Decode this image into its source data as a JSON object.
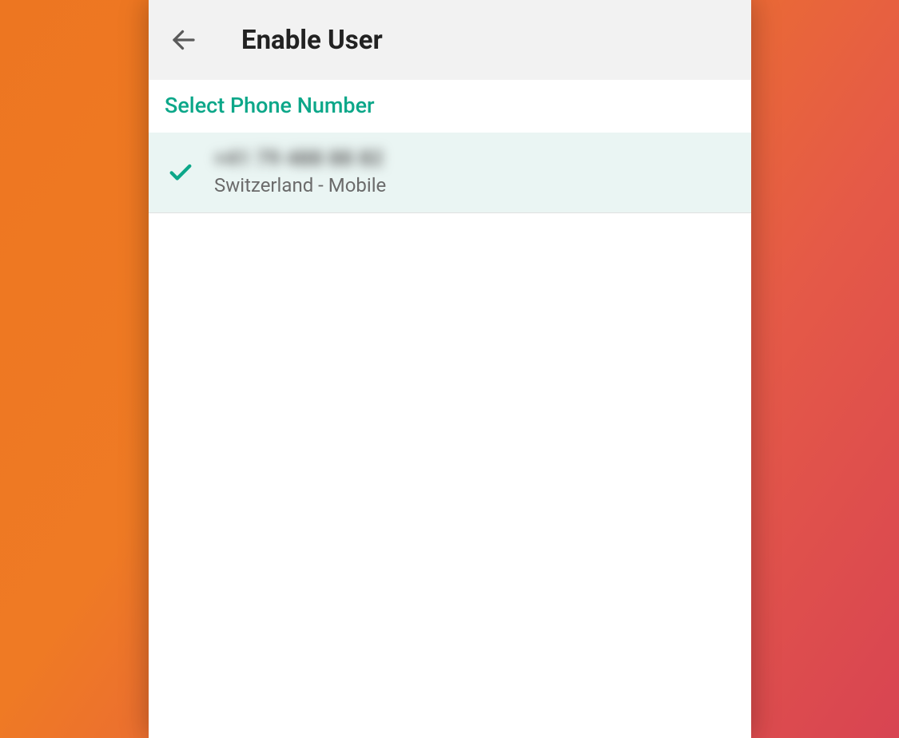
{
  "header": {
    "title": "Enable User"
  },
  "section": {
    "label": "Select Phone Number"
  },
  "phones": [
    {
      "number": "+41 79 488 88 82",
      "type": "Switzerland - Mobile",
      "selected": true
    }
  ],
  "colors": {
    "accent": "#0ca789",
    "headerBg": "#f2f2f2",
    "selectedBg": "#eaf5f3"
  }
}
